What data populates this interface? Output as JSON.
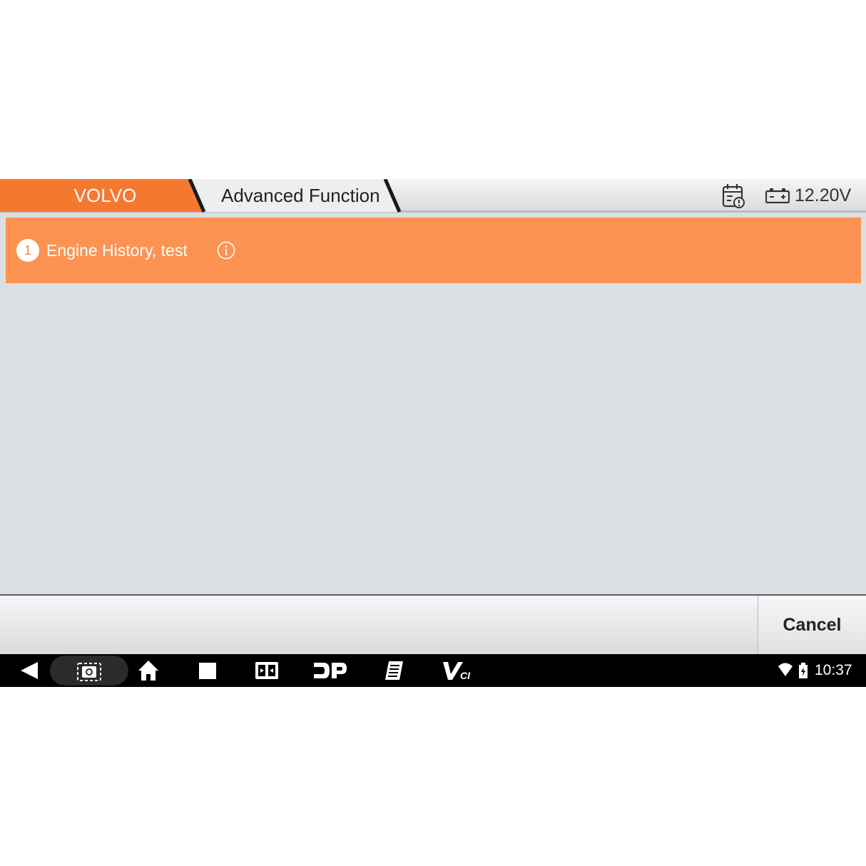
{
  "header": {
    "brand_tab": "VOLVO",
    "current_tab": "Advanced Function",
    "voltage": "12.20V",
    "icons": {
      "calendar": "calendar-icon",
      "battery": "battery-icon"
    }
  },
  "list": {
    "items": [
      {
        "number": "1",
        "label": "Engine History, test",
        "icon": "info-icon"
      }
    ]
  },
  "actions": {
    "cancel_label": "Cancel"
  },
  "navbar": {
    "time": "10:37",
    "icons": [
      "back-icon",
      "screenshot-icon",
      "home-icon",
      "recents-icon",
      "display-icon",
      "dp-icon",
      "manual-icon",
      "vci-icon",
      "wifi-icon",
      "battery-status-icon"
    ]
  },
  "colors": {
    "accent": "#fd9353",
    "tab_orange": "#f5782f",
    "background": "#dcdfe2"
  }
}
